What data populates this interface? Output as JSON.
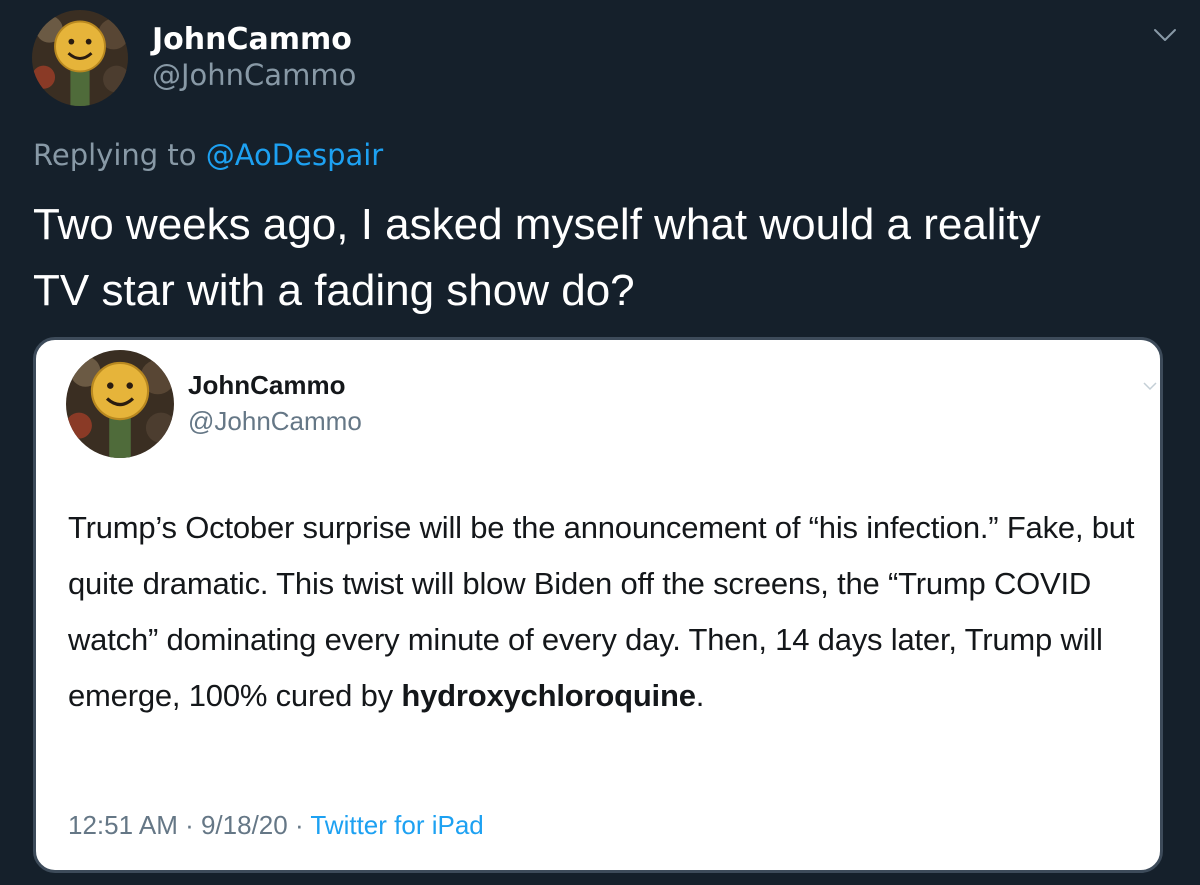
{
  "tweet": {
    "author": {
      "name": "JohnCammo",
      "handle": "@JohnCammo"
    },
    "reply_prefix": "Replying to ",
    "reply_to": "@AoDespair",
    "text_line1": "Two weeks ago, I asked myself what would a reality",
    "text_line2": "TV star with a fading show do?"
  },
  "quoted_tweet": {
    "author": {
      "name": "JohnCammo",
      "handle": "@JohnCammo"
    },
    "text_before_bold": "Trump’s October surprise will be the announcement of “his infection.”  Fake, but quite dramatic. This twist will blow Biden off the screens, the “Trump COVID watch” dominating every minute of every day.  Then, 14 days later, Trump will emerge, 100% cured by ",
    "text_bold": "hydroxychloroquine",
    "text_after_bold": ".",
    "time": "12:51 AM",
    "separator": " · ",
    "date": "9/18/20",
    "source": "Twitter for iPad"
  },
  "icons": {
    "more": "chevron-down-icon"
  },
  "colors": {
    "background": "#15202b",
    "primary_text": "#ffffff",
    "secondary_text": "#8899a6",
    "accent": "#1da1f2",
    "card_background": "#ffffff",
    "card_border": "#3d4b5a"
  }
}
